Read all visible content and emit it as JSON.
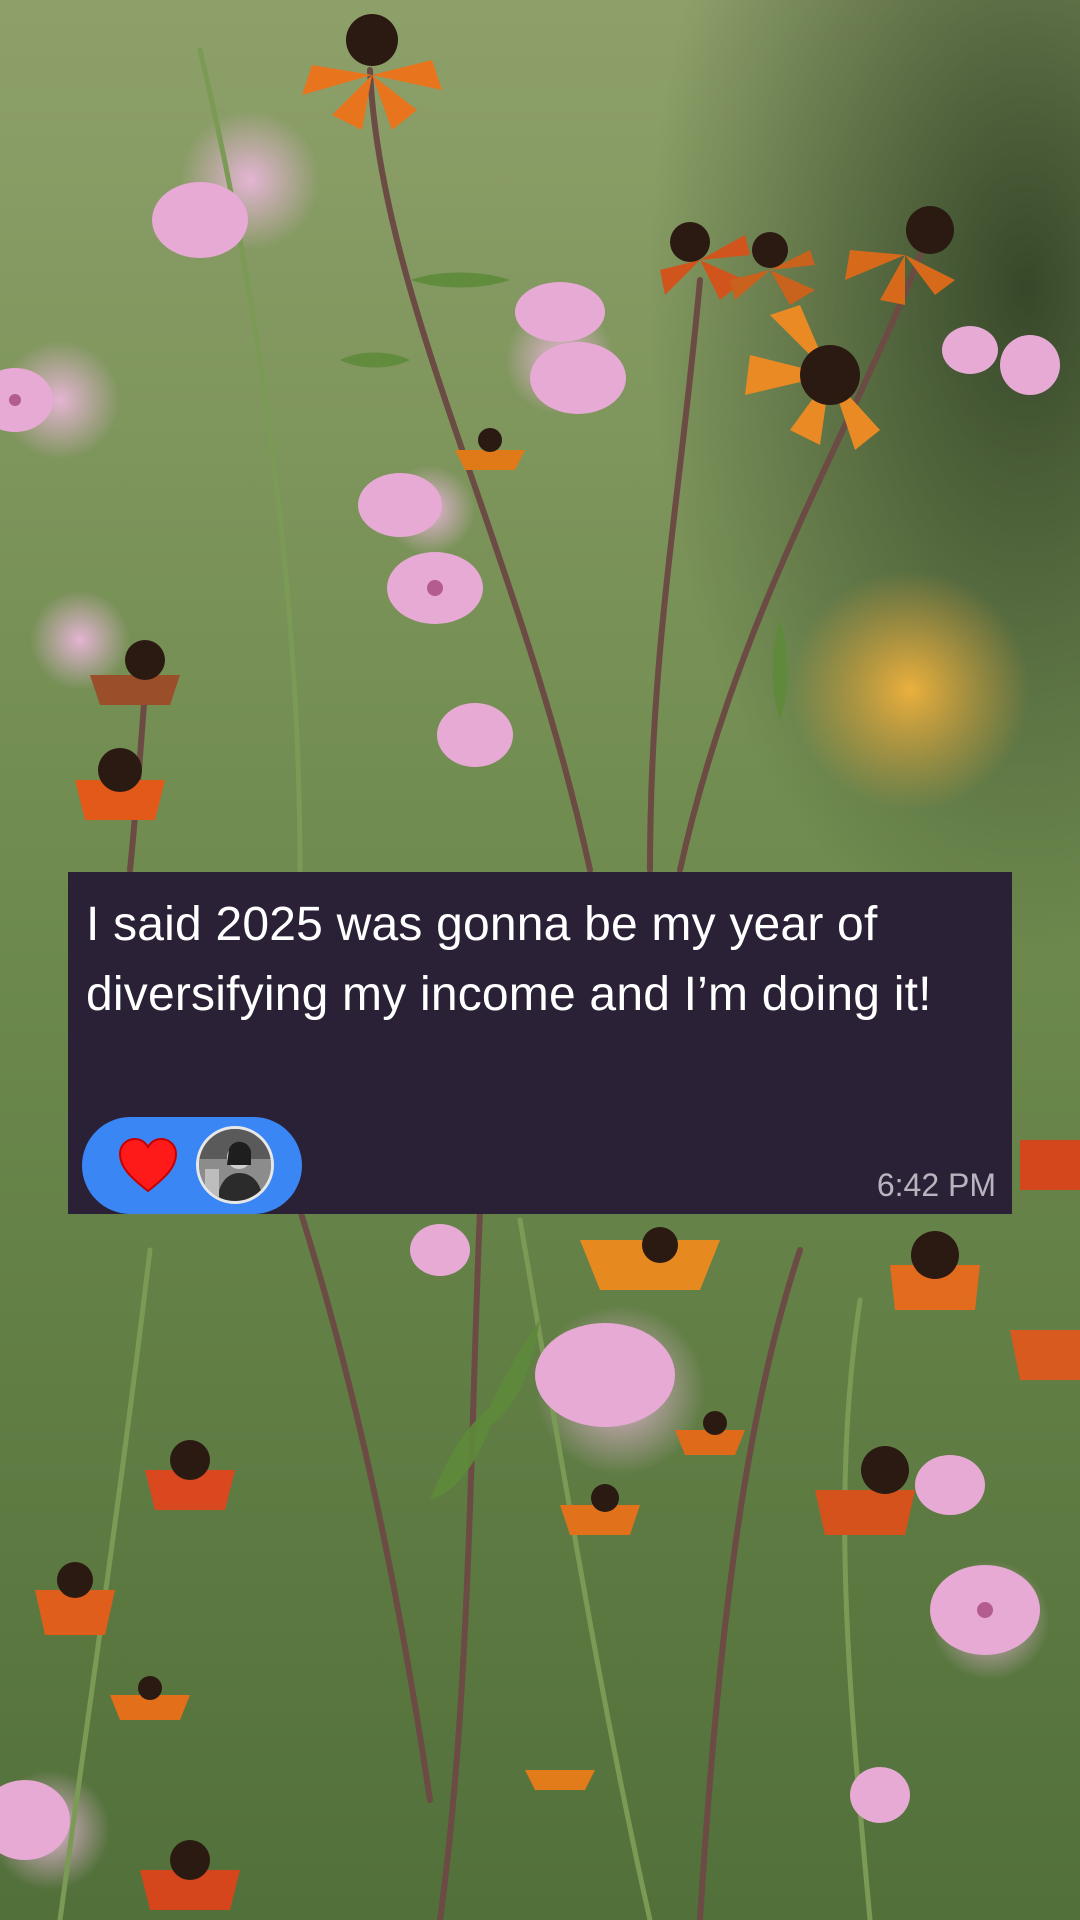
{
  "message": {
    "text": "I said 2025 was gonna be my year of diversifying my income and I’m doing it!",
    "timestamp": "6:42 PM",
    "bubble_color": "#2a2136"
  },
  "reactions": {
    "pill_color": "#3a86f5",
    "items": [
      {
        "icon": "heart-icon",
        "color": "#ff1a1a"
      },
      {
        "icon": "avatar"
      }
    ]
  },
  "background": {
    "description_icon": "wildflowers-photo"
  }
}
